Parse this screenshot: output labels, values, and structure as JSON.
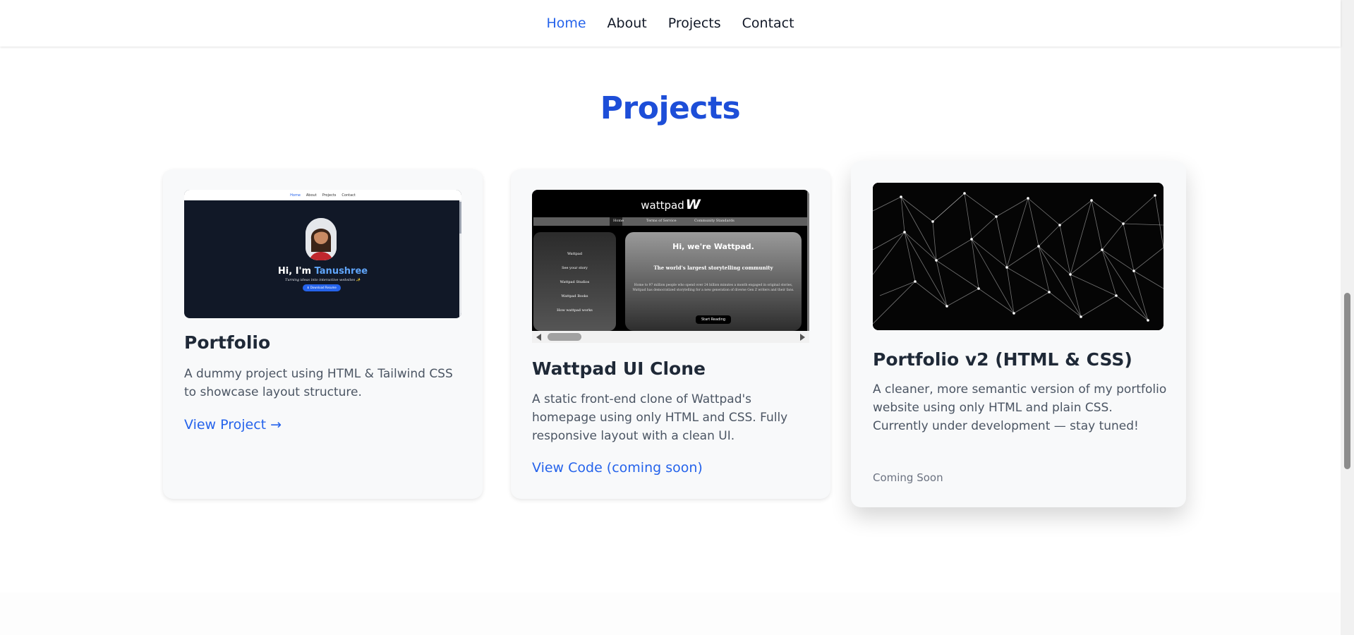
{
  "nav": {
    "items": [
      {
        "label": "Home",
        "active": true
      },
      {
        "label": "About",
        "active": false
      },
      {
        "label": "Projects",
        "active": false
      },
      {
        "label": "Contact",
        "active": false
      }
    ]
  },
  "section": {
    "title": "Projects"
  },
  "projects": [
    {
      "title": "Portfolio",
      "description": "A dummy project using HTML & Tailwind CSS to showcase layout structure.",
      "link": "View Project →",
      "preview": {
        "nav": [
          "Home",
          "About",
          "Projects",
          "Contact"
        ],
        "greeting": "Hi, I'm",
        "name": "Tanushree",
        "tagline": "Turning ideas into interactive websites ✨",
        "button": "⬇ Download Resume"
      }
    },
    {
      "title": "Wattpad UI Clone",
      "description": "A static front-end clone of Wattpad's homepage using only HTML and CSS. Fully responsive layout with a clean UI.",
      "link": "View Code (coming soon)",
      "preview": {
        "logo": "wattpad",
        "logo_mark": "W",
        "tabs": [
          "Home",
          "Terms of Service",
          "Community Standards"
        ],
        "side_items": [
          "Wattpad",
          "See your story",
          "Wattpad Studios",
          "Wattpad Books",
          "How wattpad works"
        ],
        "hero_title": "Hi, we're Wattpad.",
        "hero_subtitle": "The world's largest storytelling community",
        "hero_text": "Home to 97 million people who spend over 24 billion minutes a month engaged in original stories, Wattpad has democratized storytelling for a new generation of diverse Gen Z writers and their fans.",
        "hero_button": "Start Reading"
      }
    },
    {
      "title": "Portfolio v2 (HTML & CSS)",
      "description": "A cleaner, more semantic version of my portfolio website using only HTML and plain CSS. Currently under development — stay tuned!",
      "status": "Coming Soon"
    }
  ],
  "colors": {
    "accent": "#2563eb",
    "title": "#1d4ed8",
    "card_bg": "#f8f9fa",
    "text": "#1f2937",
    "muted": "#4b5563"
  }
}
